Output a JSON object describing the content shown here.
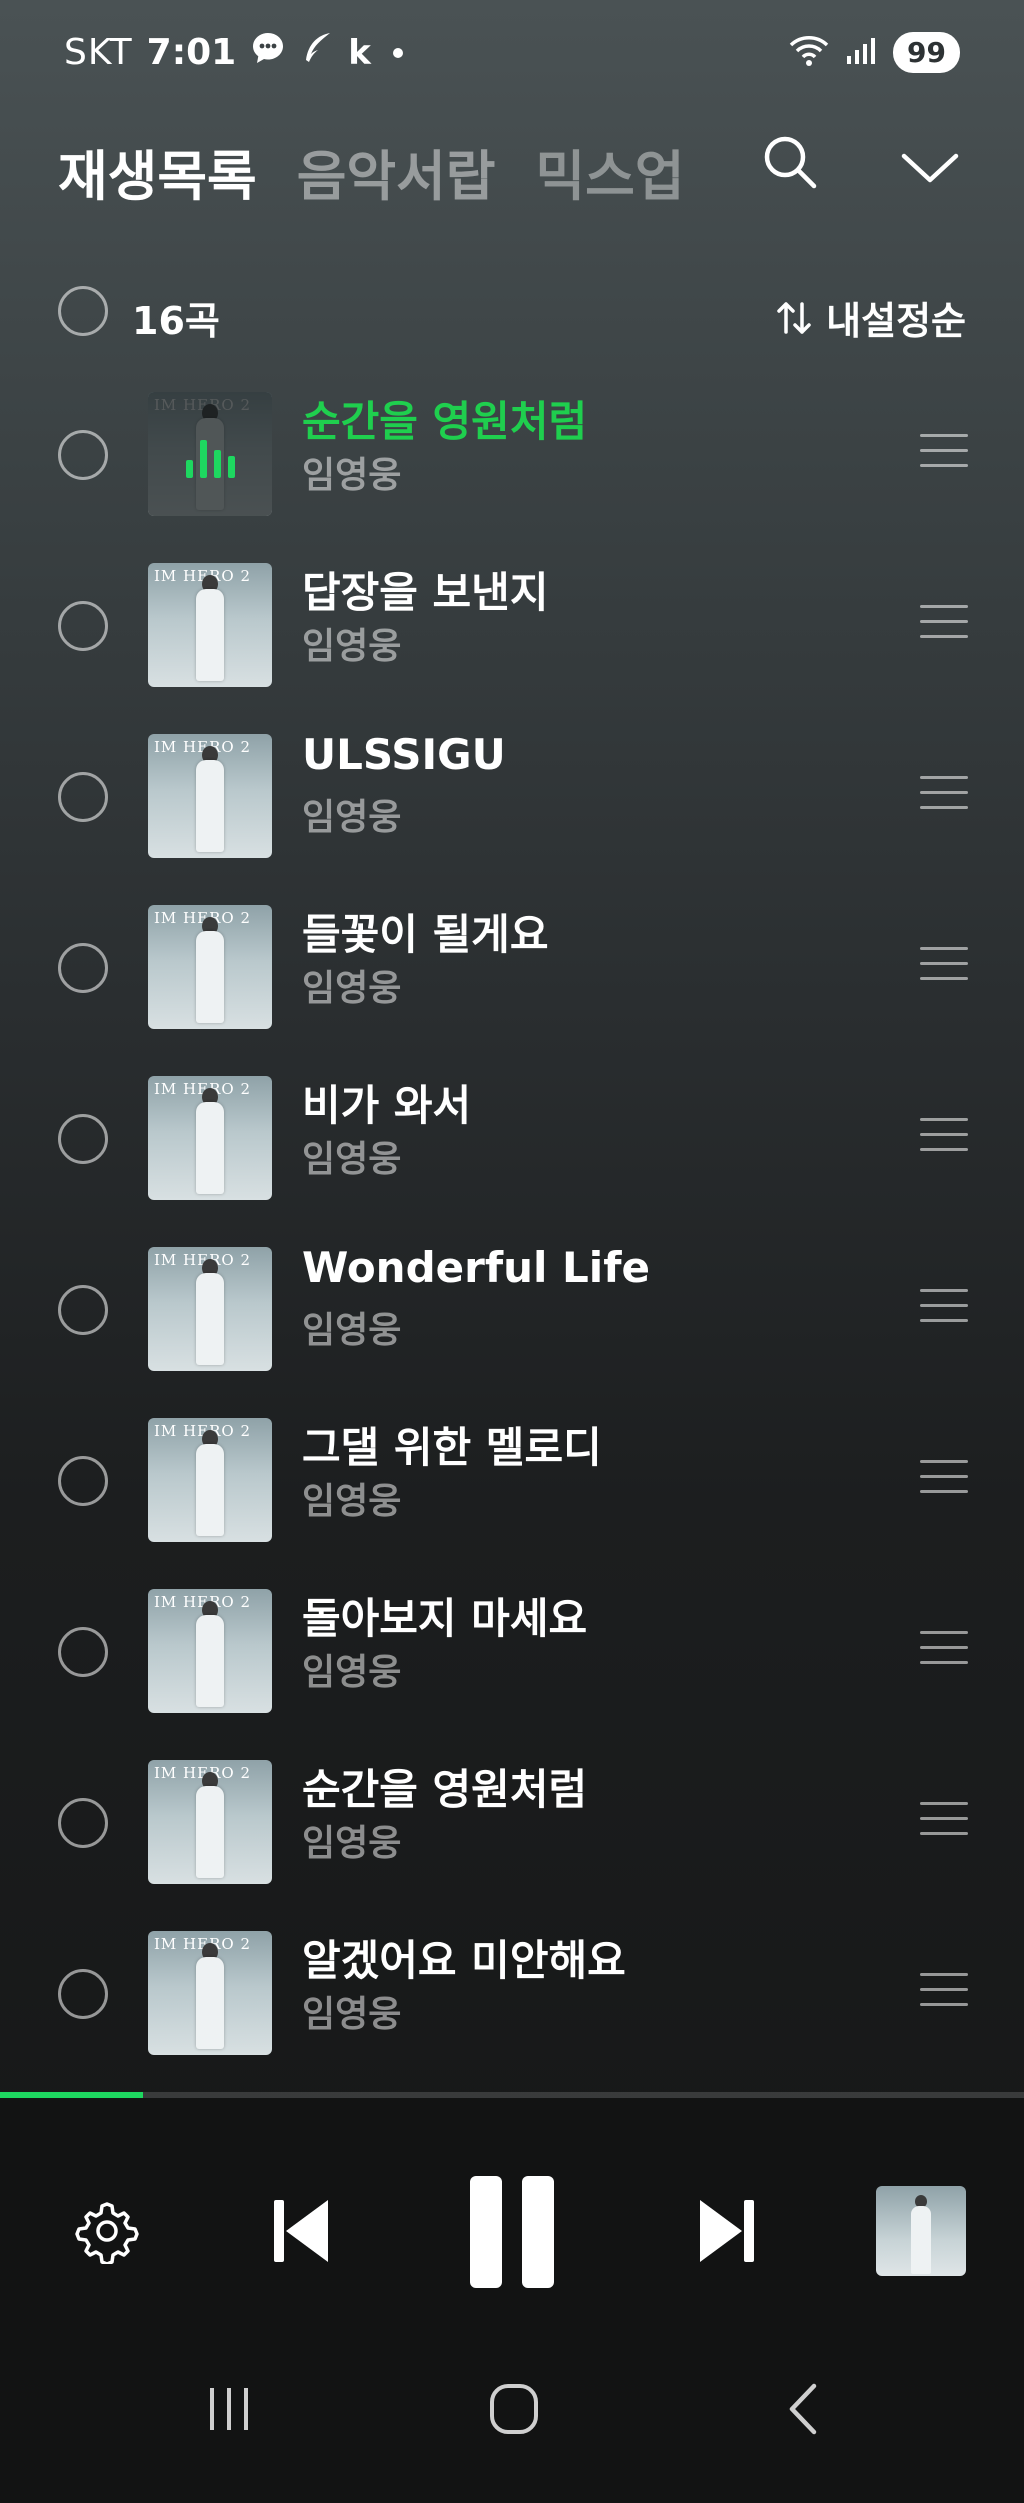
{
  "status": {
    "carrier": "SKT",
    "time": "7:01",
    "app_letter": "k",
    "battery": "99",
    "icons": [
      "chat-icon",
      "feather-icon",
      "wifi-icon",
      "signal-icon"
    ]
  },
  "tabs": [
    {
      "label": "재생목록"
    },
    {
      "label": "음악서랍"
    },
    {
      "label": "믹스업"
    }
  ],
  "list_header": {
    "count": "16곡",
    "sort_label": "내설정순"
  },
  "tracks": [
    {
      "title": "순간을 영원처럼",
      "artist": "임영웅",
      "playing": true
    },
    {
      "title": "답장을 보낸지",
      "artist": "임영웅"
    },
    {
      "title": "ULSSIGU",
      "artist": "임영웅"
    },
    {
      "title": "들꽃이 될게요",
      "artist": "임영웅"
    },
    {
      "title": "비가 와서",
      "artist": "임영웅"
    },
    {
      "title": "Wonderful Life",
      "artist": "임영웅"
    },
    {
      "title": "그댈 위한 멜로디",
      "artist": "임영웅"
    },
    {
      "title": "돌아보지 마세요",
      "artist": "임영웅"
    },
    {
      "title": "순간을 영원처럼",
      "artist": "임영웅"
    },
    {
      "title": "알겠어요 미안해요",
      "artist": "임영웅"
    }
  ],
  "album_cover_text": "IM HERO 2",
  "player": {
    "progress_fraction": 0.14,
    "state": "playing"
  },
  "colors": {
    "accent": "#1ed760",
    "now_playing_title": "#1fcf4e"
  }
}
